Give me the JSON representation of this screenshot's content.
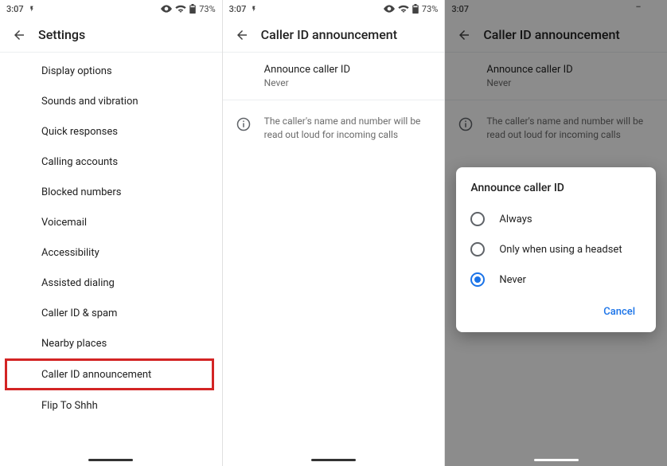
{
  "status": {
    "time": "3:07",
    "battery": "73%"
  },
  "panel1": {
    "title": "Settings",
    "items": [
      "Display options",
      "Sounds and vibration",
      "Quick responses",
      "Calling accounts",
      "Blocked numbers",
      "Voicemail",
      "Accessibility",
      "Assisted dialing",
      "Caller ID & spam",
      "Nearby places",
      "Caller ID announcement",
      "Flip To Shhh"
    ],
    "highlight_index": 10
  },
  "panel2": {
    "title": "Caller ID announcement",
    "section": {
      "title": "Announce caller ID",
      "value": "Never"
    },
    "info": "The caller's name and number will be read out loud for incoming calls"
  },
  "panel3": {
    "title": "Caller ID announcement",
    "section": {
      "title": "Announce caller ID",
      "value": "Never"
    },
    "info": "The caller's name and number will be read out loud for incoming calls",
    "dialog": {
      "title": "Announce caller ID",
      "options": [
        "Always",
        "Only when using a headset",
        "Never"
      ],
      "selected_index": 2,
      "cancel": "Cancel"
    }
  }
}
